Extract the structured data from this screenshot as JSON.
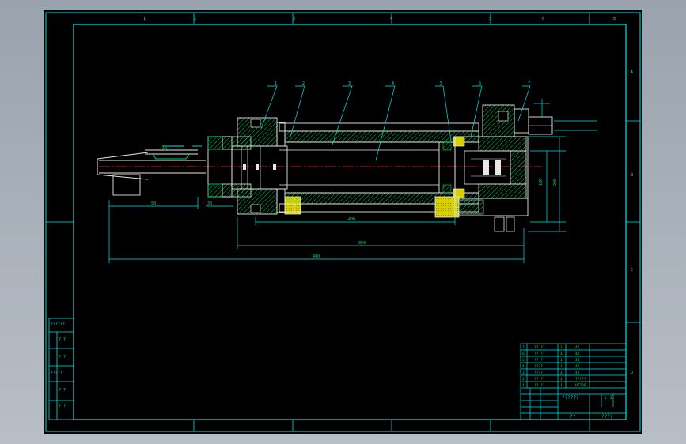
{
  "colors": {
    "frame": "#00e5e5",
    "outline": "#e8e8e8",
    "hatch": "#00e060",
    "centerline": "#ff2a2a",
    "leader": "#00e5e5",
    "fill_yellow": "#d8d000"
  },
  "border_zones": {
    "top_ticks": [
      "1",
      "2",
      "3",
      "4",
      "5",
      "6",
      "7",
      "8"
    ],
    "side_ticks": [
      "A",
      "B",
      "C",
      "D"
    ]
  },
  "left_strip": {
    "rows": [
      "??????",
      "? ?",
      "? ?",
      "?????",
      "? ?",
      "? ?"
    ]
  },
  "balloons": [
    "1",
    "2",
    "3",
    "4",
    "5",
    "6",
    "7"
  ],
  "dimensions": {
    "d_overall": "480",
    "d_body": "350",
    "d_stroke": "400",
    "d_small_1": "50",
    "d_small_2": "30",
    "d_small_3": "40",
    "d_vert_1": "180",
    "d_vert_2": "200"
  },
  "parts_list": {
    "rows": [
      [
        "7",
        "?? ??",
        "1",
        "45"
      ],
      [
        "6",
        "?? ??",
        "1",
        "45"
      ],
      [
        "5",
        "?? ??",
        "1",
        "35"
      ],
      [
        "4",
        "????",
        "1",
        "45"
      ],
      [
        "3",
        "????",
        "1",
        "45"
      ],
      [
        "2",
        "?? ??",
        "1",
        "?????"
      ],
      [
        "1",
        "?? ??",
        "1",
        "HT200"
      ]
    ]
  },
  "title_block": {
    "drawing_title": "??????",
    "scale_label": "1:1",
    "designer_label": "??",
    "school_label": "????"
  }
}
